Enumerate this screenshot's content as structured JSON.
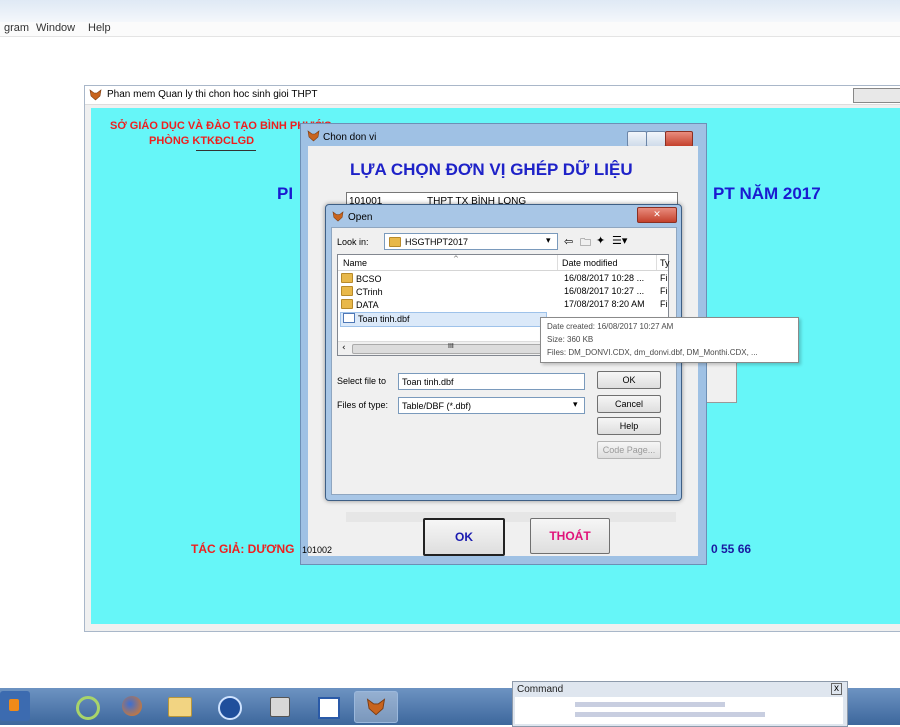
{
  "menubar": {
    "items": [
      "gram",
      "Window",
      "Help"
    ]
  },
  "app": {
    "title": "Phan mem Quan ly thi chon hoc sinh gioi THPT",
    "org_line1": "SỞ GIÁO DỤC VÀ ĐÀO TẠO BÌNH PHƯỚC",
    "org_line2": "PHÒNG KTKĐCLGD",
    "heading_left": "PI",
    "heading_right": "PT NĂM 2017",
    "author": "TÁC GIẢ: DƯƠNG",
    "phone_tail": "0 55 66"
  },
  "chon_dialog": {
    "title": "Chon don vi",
    "heading": "LỰA CHỌN ĐƠN VỊ GHÉP DỮ LIỆU",
    "row1_code": "101001",
    "row1_name": "THPT TX BÌNH LONG",
    "row_last_code": "101002",
    "ok_label": "OK",
    "exit_label": "THOÁT"
  },
  "open_dialog": {
    "title": "Open",
    "look_in_label": "Look in:",
    "look_in_value": "HSGTHPT2017",
    "columns": [
      "Name",
      "Date modified",
      "Ty"
    ],
    "files": [
      {
        "name": "BCSO",
        "date": "16/08/2017 10:28 ...",
        "type": "Fi",
        "kind": "folder"
      },
      {
        "name": "CTrinh",
        "date": "16/08/2017 10:27 ...",
        "type": "Fi",
        "kind": "folder"
      },
      {
        "name": "DATA",
        "date": "17/08/2017 8:20 AM",
        "type": "Fi",
        "kind": "folder"
      },
      {
        "name": "Toan tinh.dbf",
        "date": "",
        "type": "",
        "kind": "dbf"
      }
    ],
    "select_label": "Select file to",
    "select_value": "Toan tinh.dbf",
    "type_label": "Files of type:",
    "type_value": "Table/DBF (*.dbf)",
    "ok_label": "OK",
    "cancel_label": "Cancel",
    "help_label": "Help",
    "codepage_label": "Code Page...",
    "scroll_mid": "III"
  },
  "tooltip": {
    "line1": "Date created: 16/08/2017 10:27 AM",
    "line2": "Size: 360 KB",
    "line3": "Files: DM_DONVI.CDX, dm_donvi.dbf, DM_Monthi.CDX, ..."
  },
  "taskbar": {
    "command_title": "Command",
    "command_close": "x"
  },
  "colors": {
    "app_bg": "#66f6f8",
    "red_text": "#ee1f1f",
    "blue_text": "#1a1ad0",
    "exit_pink": "#e0137a"
  }
}
